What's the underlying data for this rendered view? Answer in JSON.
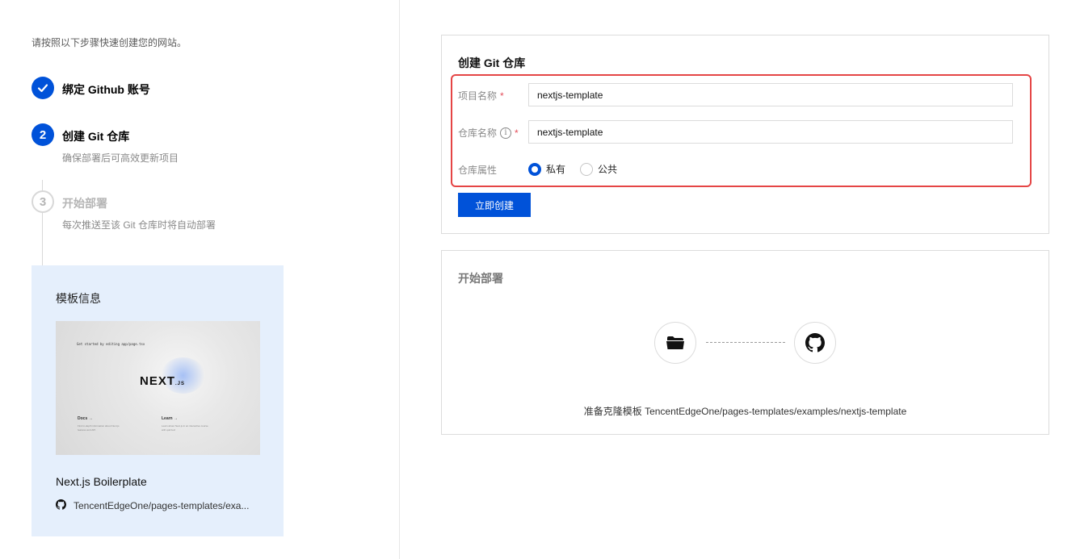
{
  "intro": "请按照以下步骤快速创建您的网站。",
  "steps": [
    {
      "number": "✓",
      "title": "绑定 Github 账号",
      "desc": ""
    },
    {
      "number": "2",
      "title": "创建 Git 仓库",
      "desc": "确保部署后可高效更新项目"
    },
    {
      "number": "3",
      "title": "开始部署",
      "desc": "每次推送至该 Git 仓库时将自动部署"
    }
  ],
  "template": {
    "heading": "模板信息",
    "thumb_small_text": "Get started by editing app/page.tsx",
    "thumb_logo": "NEXT",
    "thumb_logo_suffix": ".JS",
    "thumb_docs": "Docs →",
    "thumb_docs_text": "Find in-depth information about Next.js features and API.",
    "thumb_learn": "Learn →",
    "thumb_learn_text": "Learn about Next.js in an interactive course with quizzes!",
    "name": "Next.js Boilerplate",
    "repo": "TencentEdgeOne/pages-templates/exa..."
  },
  "create_panel": {
    "title": "创建 Git 仓库",
    "project_label": "项目名称",
    "project_value": "nextjs-template",
    "repo_label": "仓库名称",
    "repo_value": "nextjs-template",
    "visibility_label": "仓库属性",
    "private_label": "私有",
    "public_label": "公共",
    "required_mark": "*",
    "info_mark": "i",
    "create_button": "立即创建"
  },
  "deploy_panel": {
    "title": "开始部署",
    "clone_text": "准备克隆模板 TencentEdgeOne/pages-templates/examples/nextjs-template"
  },
  "colors": {
    "primary": "#0052d9",
    "highlight": "#e54545",
    "template_bg": "#e5effc"
  }
}
